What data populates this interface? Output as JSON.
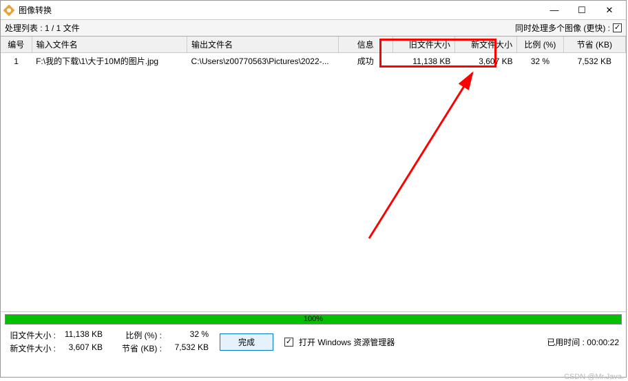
{
  "window": {
    "title": "图像转换"
  },
  "toolbar": {
    "processing_label": "处理列表 : 1 / 1 文件",
    "multi_image_label": "同时处理多个图像 (更快) :"
  },
  "table": {
    "headers": {
      "idx": "编号",
      "input": "输入文件名",
      "output": "输出文件名",
      "info": "信息",
      "oldsize": "旧文件大小",
      "newsize": "新文件大小",
      "ratio": "比例 (%)",
      "saved": "节省 (KB)"
    },
    "rows": [
      {
        "idx": "1",
        "input": "F:\\我的下载\\1\\大于10M的图片.jpg",
        "output": "C:\\Users\\z00770563\\Pictures\\2022-...",
        "info": "成功",
        "oldsize": "11,138 KB",
        "newsize": "3,607 KB",
        "ratio": "32 %",
        "saved": "7,532 KB"
      }
    ]
  },
  "progress": {
    "percent": "100%"
  },
  "footer": {
    "old_size_label": "旧文件大小 :",
    "old_size_value": "11,138 KB",
    "new_size_label": "新文件大小 :",
    "new_size_value": "3,607 KB",
    "ratio_label": "比例 (%) :",
    "ratio_value": "32 %",
    "saved_label": "节省 (KB) :",
    "saved_value": "7,532 KB",
    "done_button": "完成",
    "open_explorer_label": "打开 Windows 资源管理器",
    "elapsed_label": "已用时间 :",
    "elapsed_value": "00:00:22"
  },
  "watermark": "CSDN @Mr.Java."
}
